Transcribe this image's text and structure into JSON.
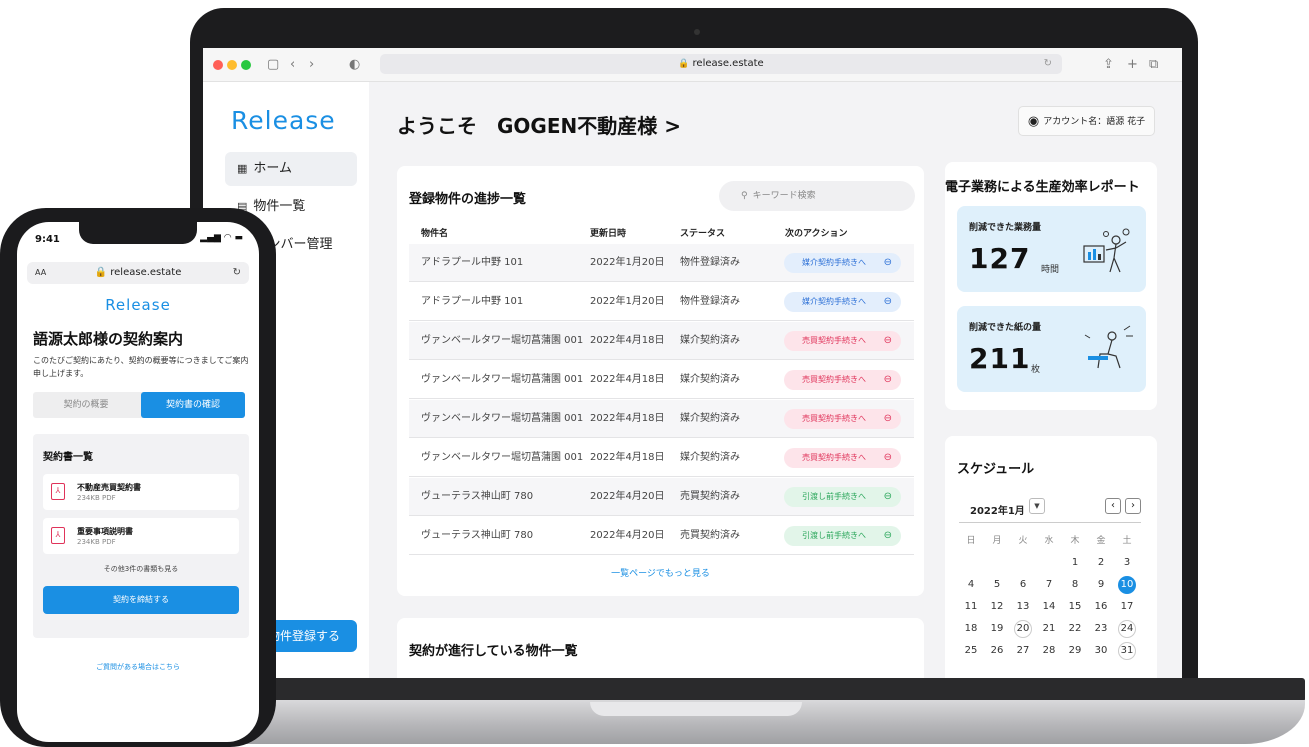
{
  "browser": {
    "url": "release.estate"
  },
  "app": {
    "brand": "Release",
    "nav": [
      {
        "label": "ホーム",
        "icon": "grid-icon"
      },
      {
        "label": "物件一覧",
        "icon": "building-icon"
      },
      {
        "label": "メンバー管理",
        "icon": "people-icon"
      }
    ],
    "register_button": "物件登録する"
  },
  "main": {
    "welcome": "ようこそ　GOGEN不動産様 >",
    "account": "アカウント名：語源 花子",
    "progress": {
      "title": "登録物件の進捗一覧",
      "search_placeholder": "キーワード検索",
      "columns": [
        "物件名",
        "更新日時",
        "ステータス",
        "次のアクション"
      ],
      "rows": [
        {
          "name": "アドラプール中野 101",
          "date": "2022年1月20日",
          "status": "物件登録済み",
          "action": "媒介契約手続きへ",
          "color": "#2b6fd6"
        },
        {
          "name": "アドラプール中野 101",
          "date": "2022年1月20日",
          "status": "物件登録済み",
          "action": "媒介契約手続きへ",
          "color": "#2b6fd6"
        },
        {
          "name": "ヴァンベールタワー堀切菖蒲園 001",
          "date": "2022年4月18日",
          "status": "媒介契約済み",
          "action": "売買契約手続きへ",
          "color": "#e0335a"
        },
        {
          "name": "ヴァンベールタワー堀切菖蒲園 001",
          "date": "2022年4月18日",
          "status": "媒介契約済み",
          "action": "売買契約手続きへ",
          "color": "#e0335a"
        },
        {
          "name": "ヴァンベールタワー堀切菖蒲園 001",
          "date": "2022年4月18日",
          "status": "媒介契約済み",
          "action": "売買契約手続きへ",
          "color": "#e0335a"
        },
        {
          "name": "ヴァンベールタワー堀切菖蒲園 001",
          "date": "2022年4月18日",
          "status": "媒介契約済み",
          "action": "売買契約手続きへ",
          "color": "#e0335a"
        },
        {
          "name": "ヴューテラス神山町 780",
          "date": "2022年4月20日",
          "status": "売買契約済み",
          "action": "引渡し前手続きへ",
          "color": "#2aa65a"
        },
        {
          "name": "ヴューテラス神山町 780",
          "date": "2022年4月20日",
          "status": "売買契約済み",
          "action": "引渡し前手続きへ",
          "color": "#2aa65a"
        }
      ],
      "more_link": "一覧ページでもっと見る"
    },
    "contracts_title": "契約が進行している物件一覧",
    "report": {
      "title": "電子業務による生産効率レポート",
      "work": {
        "label": "削減できた業務量",
        "value": "127",
        "unit": "時間"
      },
      "paper": {
        "label": "削減できた紙の量",
        "value": "211",
        "unit": "枚"
      }
    },
    "schedule": {
      "title": "スケジュール",
      "month": "2022年1月",
      "weekdays": [
        "日",
        "月",
        "火",
        "水",
        "木",
        "金",
        "土"
      ],
      "days": [
        "",
        "",
        "",
        "",
        "1",
        "2",
        "3",
        "4",
        "5",
        "6",
        "7",
        "8",
        "9",
        "10",
        "11",
        "12",
        "13",
        "14",
        "15",
        "16",
        "17",
        "18",
        "19",
        "20",
        "21",
        "22",
        "23",
        "24",
        "25",
        "26",
        "27",
        "28",
        "29",
        "30",
        "31"
      ],
      "today": "10",
      "marked": [
        "20",
        "24",
        "31"
      ]
    }
  },
  "phone": {
    "time": "9:41",
    "url": "release.estate",
    "text_size": "AA",
    "brand": "Release",
    "title": "語源太郎様の契約案内",
    "description": "このたびご契約にあたり、契約の概要等につきましてご案内申し上げます。",
    "tabs": [
      "契約の概要",
      "契約書の確認"
    ],
    "list_title": "契約書一覧",
    "documents": [
      {
        "name": "不動産売買契約書",
        "size": "234KB PDF"
      },
      {
        "name": "重要事項説明書",
        "size": "234KB PDF"
      }
    ],
    "other_docs": "その他3件の書類も見る",
    "sign_button": "契約を締結する",
    "help_link": "ご質問がある場合はこちら"
  }
}
